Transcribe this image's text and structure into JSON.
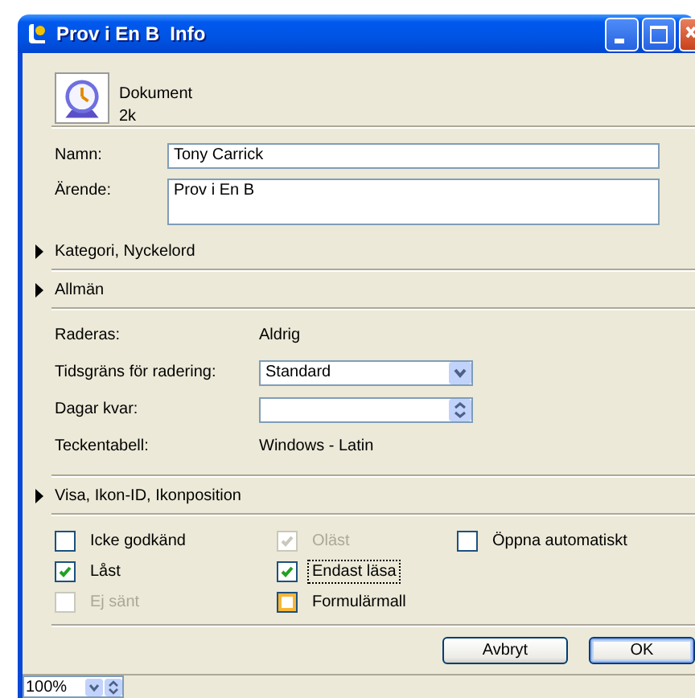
{
  "window": {
    "title": "Prov i En B  Info"
  },
  "document": {
    "type": "Dokument",
    "size": "2k"
  },
  "fields": [
    {
      "label": "Namn:",
      "value": "Tony Carrick",
      "kind": "line"
    },
    {
      "label": "Ärende:",
      "value": "Prov i En B",
      "kind": "area"
    }
  ],
  "sections": [
    {
      "title": "Kategori, Nyckelord"
    },
    {
      "title": "Allmän",
      "properties": [
        {
          "label": "Raderas:",
          "kind": "text",
          "value": "Aldrig"
        },
        {
          "label": "Tidsgräns för radering:",
          "kind": "select",
          "value": "Standard"
        },
        {
          "label": "Dagar kvar:",
          "kind": "spinner"
        },
        {
          "label": "Teckentabell:",
          "kind": "text",
          "value": "Windows - Latin"
        }
      ]
    },
    {
      "title": "Visa, Ikon-ID, Ikonposition"
    }
  ],
  "checkbox_columns": [
    [
      {
        "label": "Icke godkänd",
        "checked": false,
        "disabled": false,
        "focused": false,
        "hovered": false
      },
      {
        "label": "Låst",
        "checked": true,
        "disabled": false,
        "focused": false,
        "hovered": false
      },
      {
        "label": "Ej sänt",
        "checked": false,
        "disabled": true,
        "focused": false,
        "hovered": false
      }
    ],
    [
      {
        "label": "Oläst",
        "checked": true,
        "disabled": true,
        "focused": false,
        "hovered": false
      },
      {
        "label": "Endast läsa",
        "checked": true,
        "disabled": false,
        "focused": true,
        "hovered": false
      },
      {
        "label": "Formulärmall",
        "checked": false,
        "disabled": false,
        "focused": false,
        "hovered": true
      }
    ],
    [
      {
        "label": "Öppna automatiskt",
        "checked": false,
        "disabled": false,
        "focused": false,
        "hovered": false
      }
    ]
  ],
  "buttons": [
    {
      "label": "Avbryt",
      "default": false
    },
    {
      "label": "OK",
      "default": true
    }
  ],
  "status_bar": {
    "zoom": "100%"
  }
}
